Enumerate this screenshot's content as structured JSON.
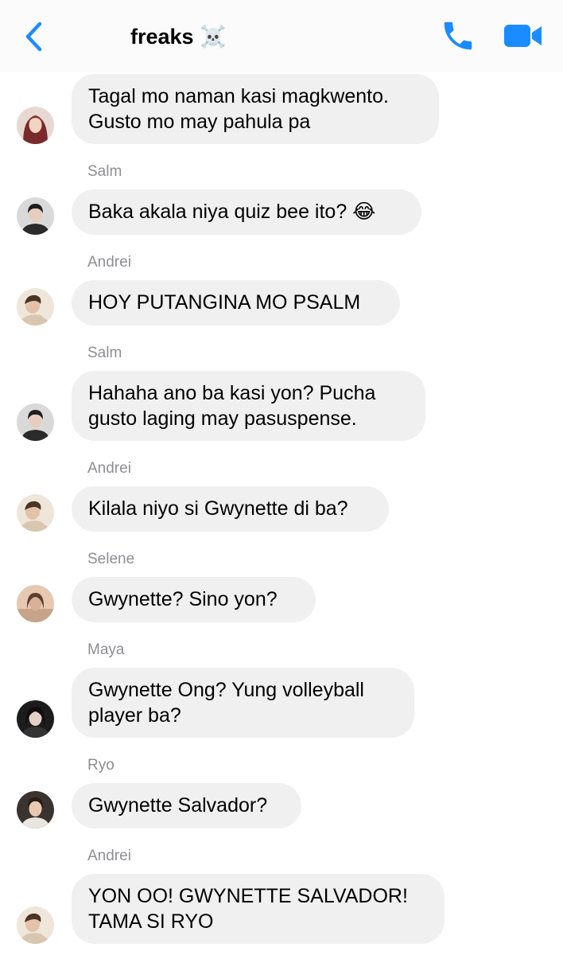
{
  "header": {
    "title": "freaks ☠️",
    "icons": [
      "back-chevron-icon",
      "phone-icon",
      "video-camera-icon"
    ],
    "accent_color": "#1a8cff"
  },
  "messages": [
    {
      "sender": "",
      "text": "Tagal mo naman kasi magkwento.\nGusto mo may pahula pa"
    },
    {
      "sender": "Salm",
      "text": "Baka akala niya quiz bee ito? 😂"
    },
    {
      "sender": "Andrei",
      "text": "HOY PUTANGINA MO PSALM"
    },
    {
      "sender": "Salm",
      "text": "Hahaha ano ba kasi yon?  Pucha\ngusto laging may pasuspense."
    },
    {
      "sender": "Andrei",
      "text": "Kilala niyo si Gwynette di ba?"
    },
    {
      "sender": "Selene",
      "text": "Gwynette? Sino yon?"
    },
    {
      "sender": "Maya",
      "text": "Gwynette Ong? Yung volleyball\nplayer ba?"
    },
    {
      "sender": "Ryo",
      "text": "Gwynette Salvador?"
    },
    {
      "sender": "Andrei",
      "text": "YON OO! GWYNETTE SALVADOR!\nTAMA SI RYO"
    }
  ]
}
